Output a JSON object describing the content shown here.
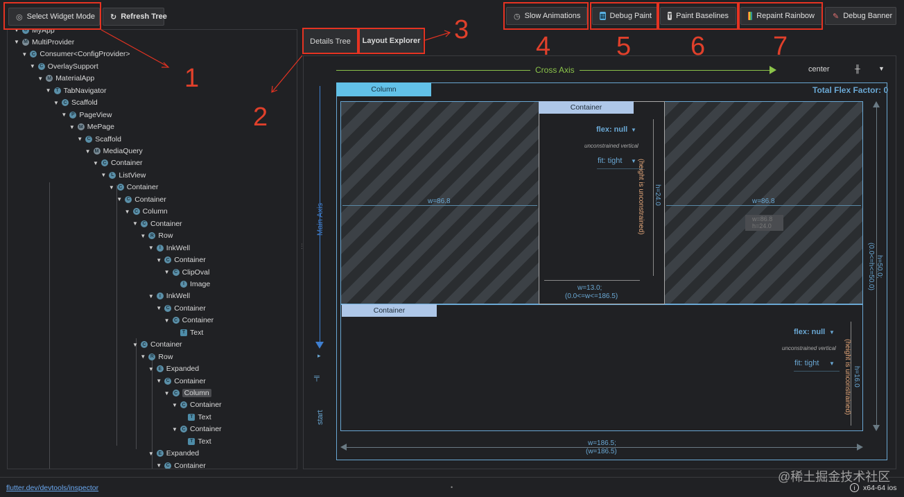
{
  "toolbar": {
    "select_widget_mode": "Select Widget Mode",
    "refresh_tree": "Refresh Tree",
    "slow_animations": "Slow Animations",
    "debug_paint": "Debug Paint",
    "paint_baselines": "Paint Baselines",
    "repaint_rainbow": "Repaint Rainbow",
    "debug_banner": "Debug Banner"
  },
  "callouts": [
    "1",
    "2",
    "3",
    "4",
    "5",
    "6",
    "7"
  ],
  "tabs": {
    "details_tree": "Details Tree",
    "layout_explorer": "Layout Explorer"
  },
  "tree": [
    {
      "label": "MyApp",
      "depth": 1,
      "icon": "C",
      "chev": true
    },
    {
      "label": "MultiProvider",
      "depth": 1,
      "icon": "M",
      "chev": true
    },
    {
      "label": "Consumer<ConfigProvider>",
      "depth": 2,
      "icon": "C",
      "chev": true
    },
    {
      "label": "OverlaySupport",
      "depth": 3,
      "icon": "C",
      "chev": true
    },
    {
      "label": "MaterialApp",
      "depth": 4,
      "icon": "M",
      "chev": true
    },
    {
      "label": "TabNavigator",
      "depth": 5,
      "icon": "T",
      "chev": true
    },
    {
      "label": "Scaffold",
      "depth": 6,
      "icon": "C",
      "chev": true
    },
    {
      "label": "PageView",
      "depth": 7,
      "icon": "P",
      "chev": true
    },
    {
      "label": "MePage",
      "depth": 8,
      "icon": "M",
      "chev": true
    },
    {
      "label": "Scaffold",
      "depth": 9,
      "icon": "C",
      "chev": true
    },
    {
      "label": "MediaQuery",
      "depth": 10,
      "icon": "M",
      "chev": true
    },
    {
      "label": "Container",
      "depth": 11,
      "icon": "C",
      "chev": true
    },
    {
      "label": "ListView",
      "depth": 12,
      "icon": "L",
      "chev": true
    },
    {
      "label": "Container",
      "depth": 13,
      "icon": "C",
      "chev": true
    },
    {
      "label": "Container",
      "depth": 14,
      "icon": "C",
      "chev": true
    },
    {
      "label": "Column",
      "depth": 15,
      "icon": "C",
      "chev": true
    },
    {
      "label": "Container",
      "depth": 16,
      "icon": "C",
      "chev": true
    },
    {
      "label": "Row",
      "depth": 17,
      "icon": "R",
      "chev": true
    },
    {
      "label": "InkWell",
      "depth": 18,
      "icon": "I",
      "chev": true
    },
    {
      "label": "Container",
      "depth": 19,
      "icon": "C",
      "chev": true
    },
    {
      "label": "ClipOval",
      "depth": 20,
      "icon": "C",
      "chev": true
    },
    {
      "label": "Image",
      "depth": 21,
      "icon": "I",
      "chev": false
    },
    {
      "label": "InkWell",
      "depth": 18,
      "icon": "I",
      "chev": true
    },
    {
      "label": "Container",
      "depth": 19,
      "icon": "C",
      "chev": true
    },
    {
      "label": "Container",
      "depth": 20,
      "icon": "C",
      "chev": true
    },
    {
      "label": "Text",
      "depth": 21,
      "icon": "T",
      "chev": false
    },
    {
      "label": "Container",
      "depth": 16,
      "icon": "C",
      "chev": true
    },
    {
      "label": "Row",
      "depth": 17,
      "icon": "R",
      "chev": true
    },
    {
      "label": "Expanded",
      "depth": 18,
      "icon": "E",
      "chev": true
    },
    {
      "label": "Container",
      "depth": 19,
      "icon": "C",
      "chev": true
    },
    {
      "label": "Column",
      "depth": 20,
      "icon": "C",
      "chev": true,
      "selected": true
    },
    {
      "label": "Container",
      "depth": 21,
      "icon": "C",
      "chev": true
    },
    {
      "label": "Text",
      "depth": 22,
      "icon": "T",
      "chev": false
    },
    {
      "label": "Container",
      "depth": 21,
      "icon": "C",
      "chev": true
    },
    {
      "label": "Text",
      "depth": 22,
      "icon": "T",
      "chev": false
    },
    {
      "label": "Expanded",
      "depth": 18,
      "icon": "E",
      "chev": true
    },
    {
      "label": "Container",
      "depth": 19,
      "icon": "C",
      "chev": true
    }
  ],
  "layout": {
    "cross_axis": "Cross Axis",
    "main_axis": "Main Axis",
    "cross_alignment": "center",
    "main_alignment": "start",
    "column_label": "Column",
    "total_flex": "Total Flex Factor: 0",
    "child1": {
      "label": "Container",
      "flex": "flex: null",
      "unconstrained": "unconstrained vertical",
      "fit": "fit: tight",
      "height_note": "(height is unconstrained)",
      "h": "h=24.0",
      "w_line1": "w=13.0;",
      "w_line2": "(0.0<=w<=186.5)"
    },
    "left_w": "w=86.8",
    "right_w": "w=86.8",
    "ghost_w": "w=86.8",
    "ghost_h": "h=24.0",
    "child2": {
      "label": "Container",
      "flex": "flex: null",
      "unconstrained": "unconstrained vertical",
      "fit": "fit: tight",
      "height_note": "(height is unconstrained)",
      "h": "h=16.0"
    },
    "outer_h_line1": "h=50.0;",
    "outer_h_line2": "(0.0<=h<=50.0)",
    "outer_w_line1": "w=186.5;",
    "outer_w_line2": "(w=186.5)"
  },
  "footer": {
    "link": "flutter.dev/devtools/inspector",
    "watermark": "@稀土掘金技术社区",
    "platform": "x64-64 ios"
  }
}
